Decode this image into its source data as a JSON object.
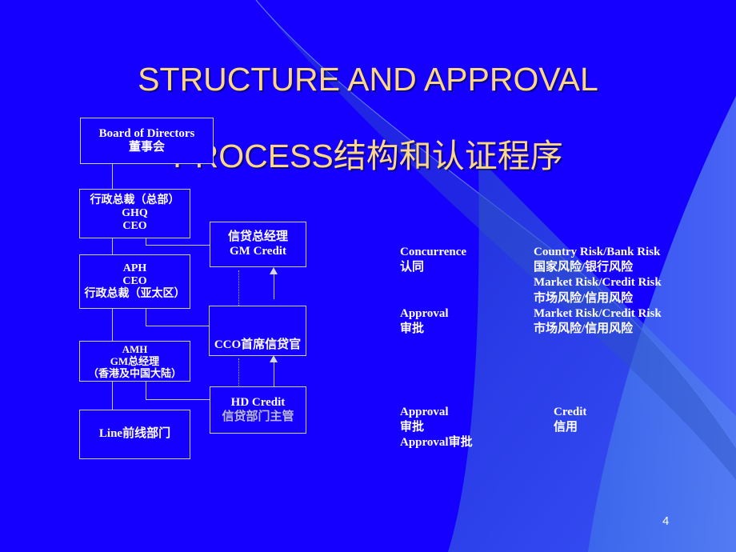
{
  "slide": {
    "page_number": "4",
    "background_color": "#1500FF",
    "accent_color": "#4A7BEA",
    "title_color": "#FCD886",
    "title_line1": "STRUCTURE AND APPROVAL",
    "title_line2": "PROCESS结构和认证程序"
  },
  "org_chart": {
    "nodes": [
      {
        "id": "board",
        "line1": "Board of Directors",
        "line2": "董事会"
      },
      {
        "id": "ghq",
        "line1": "行政总裁（总部）",
        "line2": "GHQ",
        "line3": "CEO"
      },
      {
        "id": "aph",
        "line1": "APH",
        "line2": "CEO",
        "line3": "行政总裁（亚太区）"
      },
      {
        "id": "amh",
        "line1": "AMH",
        "line2": "GM总经理",
        "line3": "（香港及中国大陆）"
      },
      {
        "id": "line",
        "line1": "Line前线部门"
      },
      {
        "id": "gm_credit",
        "line1": "信贷总经理",
        "line2": "GM Credit"
      },
      {
        "id": "cco",
        "line1": "CCO首席信贷官"
      },
      {
        "id": "hd_credit",
        "line1": "HD Credit",
        "line2": "信贷部门主管"
      }
    ]
  },
  "legend": {
    "block_top": {
      "left_lines": [
        "Concurrence",
        "认同",
        "",
        "",
        "Approval",
        " 审批"
      ],
      "right_lines": [
        "Country Risk/Bank Risk",
        "国家风险/银行风险",
        "Market Risk/Credit Risk",
        "市场风险/信用风险",
        "Market Risk/Credit Risk",
        "市场风险/信用风险"
      ]
    },
    "block_bottom": {
      "left_lines": [
        "Approval",
        "审批",
        "Approval审批"
      ],
      "right_lines": [
        "Credit",
        "信用"
      ]
    }
  }
}
